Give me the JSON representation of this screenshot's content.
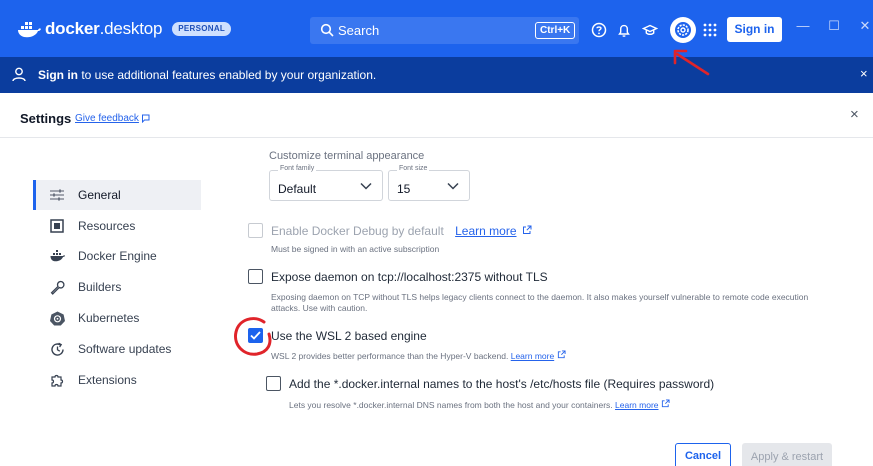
{
  "titlebar": {
    "logo_prefix": "docker",
    "logo_suffix": ".desktop",
    "plan_badge": "PERSONAL",
    "search_placeholder": "Search",
    "shortcut": "Ctrl+K",
    "signin": "Sign in",
    "icons": [
      "help-icon",
      "bell-icon",
      "learning-icon",
      "gear-icon",
      "grid-icon"
    ]
  },
  "banner": {
    "link": "Sign in",
    "text": " to use additional features enabled by your organization.",
    "close": "×"
  },
  "header": {
    "title": "Settings",
    "feedback": "Give feedback",
    "close": "×"
  },
  "sidebar": {
    "items": [
      {
        "label": "General",
        "icon": "sliders-icon",
        "active": true
      },
      {
        "label": "Resources",
        "icon": "resources-icon",
        "active": false
      },
      {
        "label": "Docker Engine",
        "icon": "whale-icon",
        "active": false
      },
      {
        "label": "Builders",
        "icon": "wrench-icon",
        "active": false
      },
      {
        "label": "Kubernetes",
        "icon": "helm-icon",
        "active": false
      },
      {
        "label": "Software updates",
        "icon": "update-icon",
        "active": false
      },
      {
        "label": "Extensions",
        "icon": "puzzle-icon",
        "active": false
      }
    ]
  },
  "content": {
    "terminal_heading": "Customize terminal appearance",
    "font_family": {
      "legend": "Font family",
      "value": "Default"
    },
    "font_size": {
      "legend": "Font size",
      "value": "15"
    },
    "debug": {
      "label": "Enable Docker Debug by default",
      "learn_more": "Learn more",
      "help": "Must be signed in with an active subscription",
      "checked": false,
      "disabled": true
    },
    "expose_daemon": {
      "label": "Expose daemon on tcp://localhost:2375 without TLS",
      "help_line1": "Exposing daemon on TCP without TLS helps legacy clients connect to the daemon. It also makes yourself vulnerable to remote code execution",
      "help_line2": "attacks. Use with caution.",
      "checked": false
    },
    "wsl2": {
      "label": "Use the WSL 2 based engine",
      "help": "WSL 2 provides better performance than the Hyper-V backend.",
      "learn_more": "Learn more",
      "checked": true
    },
    "hosts": {
      "label": "Add the *.docker.internal names to the host's /etc/hosts file (Requires password)",
      "help": "Lets you resolve *.docker.internal DNS names from both the host and your containers.",
      "learn_more": "Learn more",
      "checked": false
    }
  },
  "footer": {
    "cancel": "Cancel",
    "apply": "Apply & restart"
  },
  "colors": {
    "brand_blue": "#1d63ed",
    "banner_blue": "#0b3d9e",
    "annotation_red": "#e0242a"
  }
}
